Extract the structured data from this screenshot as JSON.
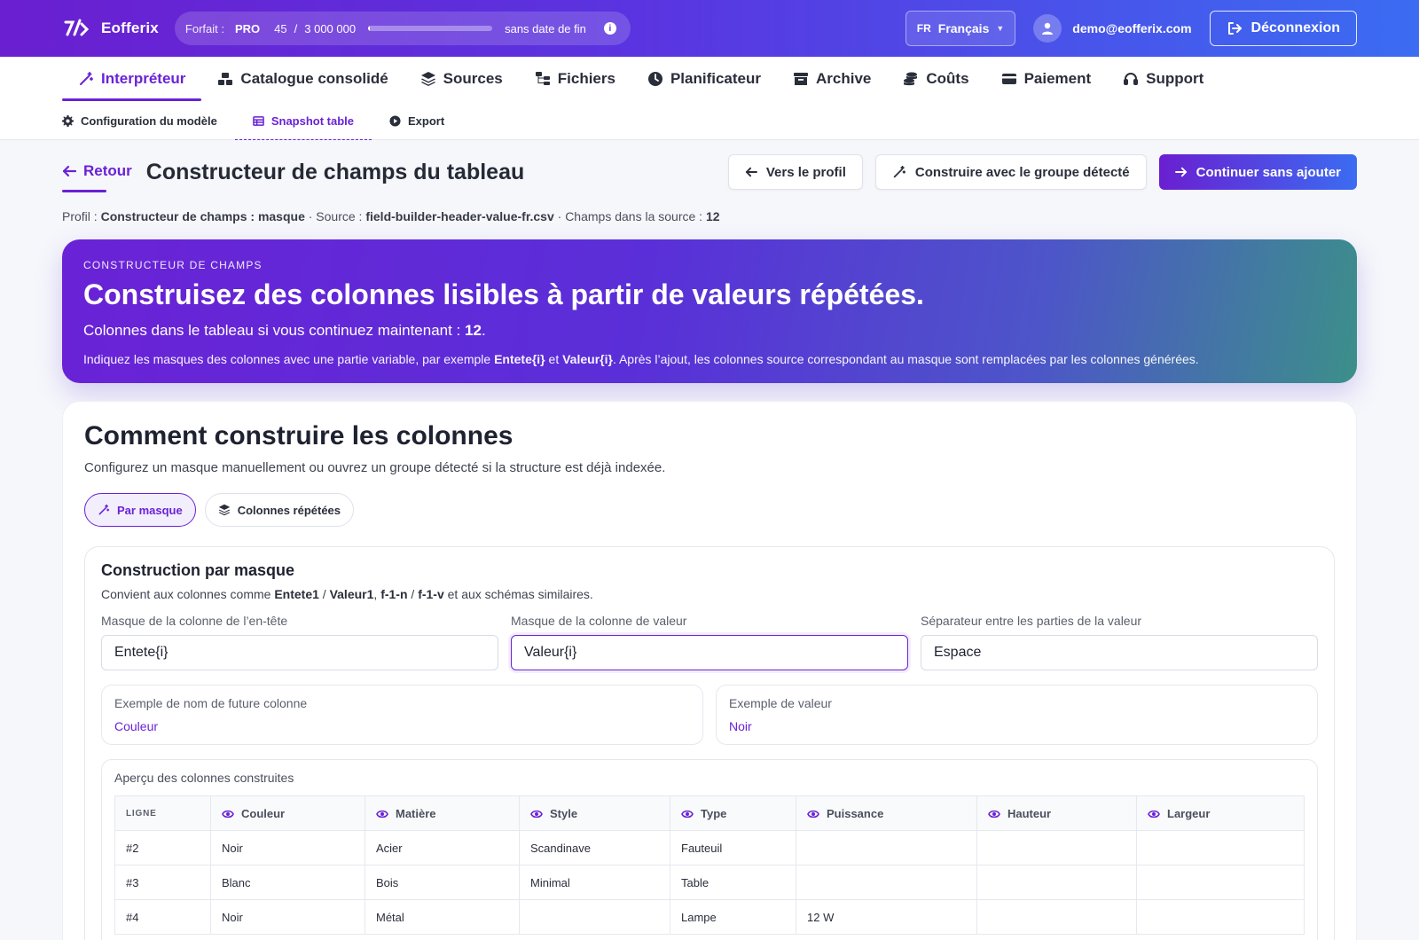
{
  "topbar": {
    "brand": "Eofferix",
    "plan_label": "Forfait :",
    "plan_tier": "PRO",
    "plan_used": "45",
    "plan_sep": "/",
    "plan_total": "3 000 000",
    "plan_usage_fraction": 1.5e-05,
    "plan_end": "sans date de fin",
    "lang_code": "FR",
    "lang_name": "Français",
    "user_email": "demo@eofferix.com",
    "logout_label": "Déconnexion"
  },
  "nav": {
    "items": [
      {
        "label": "Interpréteur",
        "icon": "magic-wand-icon",
        "active": true
      },
      {
        "label": "Catalogue consolidé",
        "icon": "cubes-icon",
        "active": false
      },
      {
        "label": "Sources",
        "icon": "layers-icon",
        "active": false
      },
      {
        "label": "Fichiers",
        "icon": "sitemap-icon",
        "active": false
      },
      {
        "label": "Planificateur",
        "icon": "clock-icon",
        "active": false
      },
      {
        "label": "Archive",
        "icon": "archive-icon",
        "active": false
      },
      {
        "label": "Coûts",
        "icon": "coins-icon",
        "active": false
      },
      {
        "label": "Paiement",
        "icon": "credit-card-icon",
        "active": false
      },
      {
        "label": "Support",
        "icon": "headset-icon",
        "active": false
      }
    ]
  },
  "subnav": {
    "items": [
      {
        "label": "Configuration du modèle",
        "icon": "gear-icon",
        "active": false
      },
      {
        "label": "Snapshot table",
        "icon": "table-icon",
        "active": true
      },
      {
        "label": "Export",
        "icon": "play-circle-icon",
        "active": false
      }
    ]
  },
  "header": {
    "back_label": "Retour",
    "title": "Constructeur de champs du tableau",
    "btn_profile": "Vers le profil",
    "btn_build_group": "Construire avec le groupe détecté",
    "btn_continue": "Continuer sans ajouter"
  },
  "meta": {
    "profile_label": "Profil :",
    "profile_value": "Constructeur de champs : masque",
    "source_label": "· Source :",
    "source_value": "field-builder-header-value-fr.csv",
    "fields_label": "· Champs dans la source :",
    "fields_value": "12"
  },
  "hero": {
    "eyebrow": "CONSTRUCTEUR DE CHAMPS",
    "title": "Construisez des colonnes lisibles à partir de valeurs répétées.",
    "count_label": "Colonnes dans le tableau si vous continuez maintenant :",
    "count_value": "12",
    "desc_1": "Indiquez les masques des colonnes avec une partie variable, par exemple",
    "desc_ex1": "Entete{i}",
    "desc_and": "et",
    "desc_ex2": "Valeur{i}",
    "desc_2": ". Après l’ajout, les colonnes source correspondant au masque sont remplacées par les colonnes générées."
  },
  "card": {
    "title": "Comment construire les colonnes",
    "subtitle": "Configurez un masque manuellement ou ouvrez un groupe détecté si la structure est déjà indexée.",
    "mode_mask": "Par masque",
    "mode_repeated": "Colonnes répétées"
  },
  "builder": {
    "title": "Construction par masque",
    "sub_1": "Convient aux colonnes comme",
    "sub_ex1": "Entete1",
    "sub_slash1": "/",
    "sub_ex2": "Valeur1",
    "sub_comma": ",",
    "sub_ex3": "f-1-n",
    "sub_slash2": "/",
    "sub_ex4": "f-1-v",
    "sub_2": "et aux schémas similaires.",
    "header_mask_label": "Masque de la colonne de l’en-tête",
    "header_mask_value": "Entete{i}",
    "value_mask_label": "Masque de la colonne de valeur",
    "value_mask_value": "Valeur{i}",
    "separator_label": "Séparateur entre les parties de la valeur",
    "separator_value": "Espace",
    "example_name_label": "Exemple de nom de future colonne",
    "example_name_value": "Couleur",
    "example_value_label": "Exemple de valeur",
    "example_value_value": "Noir"
  },
  "preview": {
    "title": "Aperçu des colonnes construites",
    "columns": [
      "LIGNE",
      "Couleur",
      "Matière",
      "Style",
      "Type",
      "Puissance",
      "Hauteur",
      "Largeur"
    ],
    "rows": [
      [
        "#2",
        "Noir",
        "Acier",
        "Scandinave",
        "Fauteuil",
        "",
        "",
        ""
      ],
      [
        "#3",
        "Blanc",
        "Bois",
        "Minimal",
        "Table",
        "",
        "",
        ""
      ],
      [
        "#4",
        "Noir",
        "Métal",
        "",
        "Lampe",
        "12 W",
        "",
        ""
      ]
    ]
  },
  "colors": {
    "accent": "#6a22d6",
    "gradient_start": "#6a1fd0",
    "gradient_end": "#3b6cf2"
  }
}
